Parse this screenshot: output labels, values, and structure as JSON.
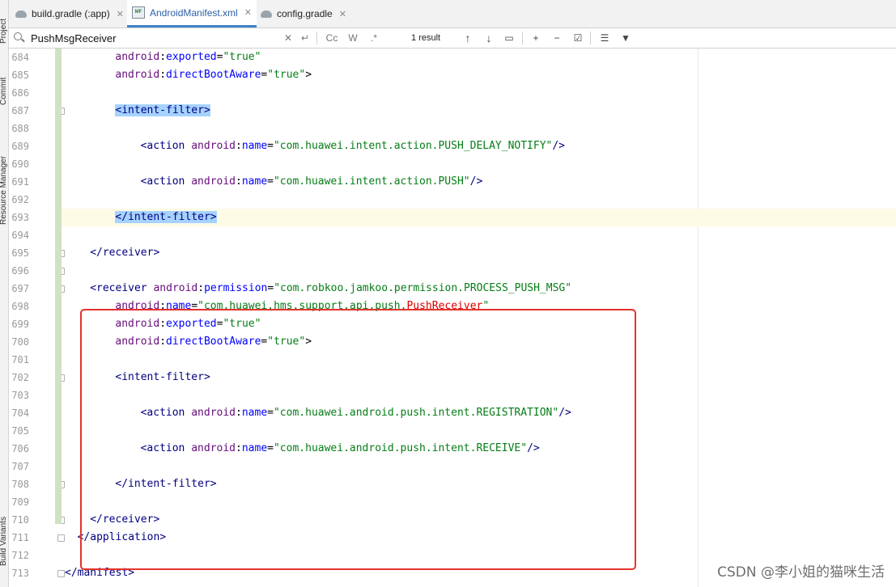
{
  "tool_window_labels": [
    "Project",
    "Commit",
    "Resource Manager",
    "Build Variants"
  ],
  "tabs": [
    {
      "label": "build.gradle (:app)",
      "icon": "gradle-icon",
      "active": false
    },
    {
      "label": "AndroidManifest.xml",
      "icon": "manifest-icon",
      "active": true
    },
    {
      "label": "config.gradle",
      "icon": "gradle-icon",
      "active": false
    }
  ],
  "search": {
    "value": "PushMsgReceiver",
    "result": "1 result",
    "match_case": "Cc",
    "words": "W",
    "regex": ".*"
  },
  "editor": {
    "line_numbers": [
      "684",
      "685",
      "686",
      "687",
      "688",
      "689",
      "690",
      "691",
      "692",
      "693",
      "694",
      "695",
      "696",
      "697",
      "698",
      "699",
      "700",
      "701",
      "702",
      "703",
      "704",
      "705",
      "706",
      "707",
      "708",
      "709",
      "710",
      "711",
      "712",
      "713"
    ],
    "current_line": "693"
  },
  "watermark": "CSDN @李小姐的猫咪生活",
  "colors": {
    "tag": "#000080",
    "attr_ns": "#660e7a",
    "attr_name": "#0000ff",
    "string": "#067d17",
    "highlight": "#a6d2ff",
    "annotation_box": "#e5322d"
  }
}
